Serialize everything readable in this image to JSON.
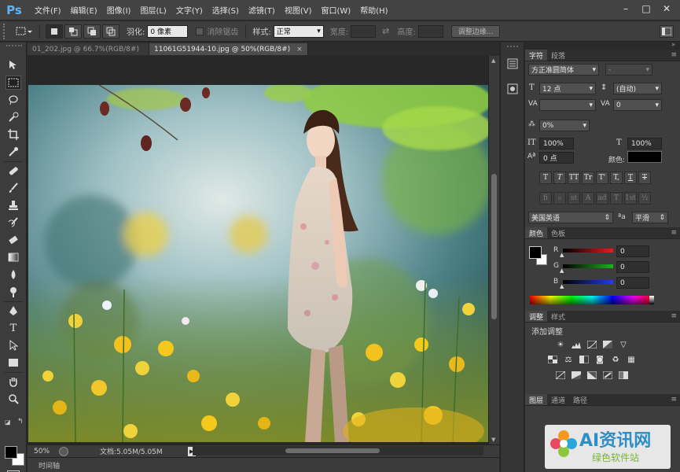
{
  "app": {
    "logo": "Ps",
    "menus": [
      "文件(F)",
      "编辑(E)",
      "图像(I)",
      "图层(L)",
      "文字(Y)",
      "选择(S)",
      "滤镜(T)",
      "视图(V)",
      "窗口(W)",
      "帮助(H)"
    ],
    "window_controls": [
      "–",
      "□",
      "✕"
    ]
  },
  "options": {
    "feather_label": "羽化:",
    "feather_value": "0 像素",
    "antialias_label": "消除锯齿",
    "style_label": "样式:",
    "style_value": "正常",
    "width_label": "宽度:",
    "height_label": "高度:",
    "refine_edge": "调整边缘..."
  },
  "documents": {
    "tabs": [
      {
        "label": "01_202.jpg @ 66.7%(RGB/8#)",
        "active": false
      },
      {
        "label": "11061G51944-10.jpg @ 50%(RGB/8#)",
        "active": true
      }
    ]
  },
  "status": {
    "zoom": "50%",
    "doc_info": "文档:5.05M/5.05M",
    "timeline": "时间轴"
  },
  "character": {
    "tabs": [
      "字符",
      "段落"
    ],
    "font_family": "方正准圆简体",
    "font_style": "-",
    "font_size": "12 点",
    "leading": "(自动)",
    "kerning": "",
    "tracking": "0",
    "tsume": "0%",
    "vertical_scale": "100%",
    "horizontal_scale": "100%",
    "baseline_shift": "0 点",
    "color_label": "颜色:",
    "style_buttons": [
      "T",
      "T",
      "TT",
      "Tr",
      "T'",
      "T,",
      "T",
      "T"
    ],
    "opentype_buttons": [
      "fi",
      "ℴ",
      "st",
      "A",
      "ad",
      "T",
      "1st",
      "½"
    ],
    "language": "美国英语",
    "aa_prefix": "ªa",
    "antialias": "平滑"
  },
  "color_panel": {
    "tabs": [
      "颜色",
      "色板"
    ],
    "channels": [
      {
        "label": "R",
        "value": "0",
        "color": "#e02020"
      },
      {
        "label": "G",
        "value": "0",
        "color": "#20b020"
      },
      {
        "label": "B",
        "value": "0",
        "color": "#2040e0"
      }
    ]
  },
  "adjustments": {
    "tabs": [
      "调整",
      "样式"
    ],
    "title": "添加调整"
  },
  "layers": {
    "tabs": [
      "图层",
      "通道",
      "路径"
    ]
  },
  "watermark": {
    "text": "AI资讯网",
    "sub": "绿色软件站"
  }
}
